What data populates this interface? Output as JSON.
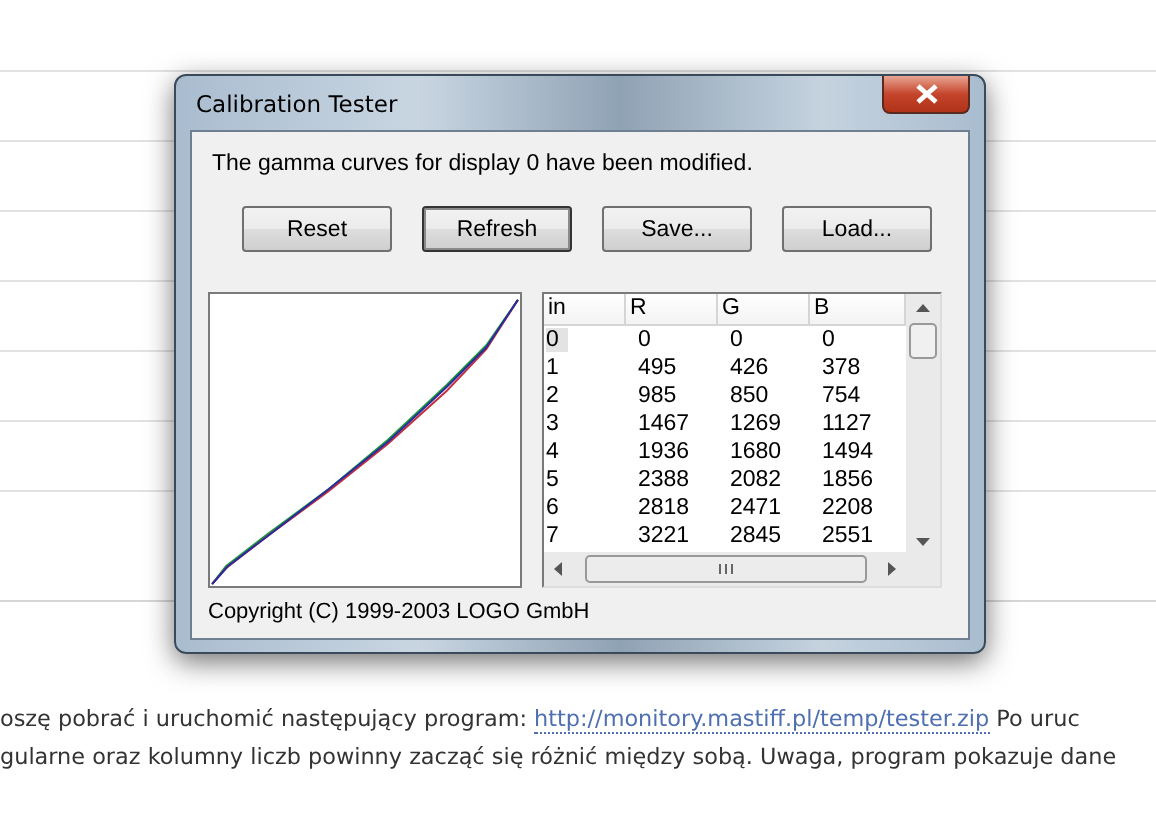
{
  "window": {
    "title": "Calibration Tester"
  },
  "message": "The gamma curves for display 0 have been modified.",
  "buttons": [
    {
      "label": "Reset",
      "default": false
    },
    {
      "label": "Refresh",
      "default": true
    },
    {
      "label": "Save...",
      "default": false
    },
    {
      "label": "Load...",
      "default": false
    }
  ],
  "table": {
    "columns": [
      "in",
      "R",
      "G",
      "B"
    ],
    "rows": [
      {
        "cells": [
          "0",
          "0",
          "0",
          "0"
        ],
        "selected": true
      },
      {
        "cells": [
          "1",
          "495",
          "426",
          "378"
        ],
        "selected": false
      },
      {
        "cells": [
          "2",
          "985",
          "850",
          "754"
        ],
        "selected": false
      },
      {
        "cells": [
          "3",
          "1467",
          "1269",
          "1127"
        ],
        "selected": false
      },
      {
        "cells": [
          "4",
          "1936",
          "1680",
          "1494"
        ],
        "selected": false
      },
      {
        "cells": [
          "5",
          "2388",
          "2082",
          "1856"
        ],
        "selected": false
      },
      {
        "cells": [
          "6",
          "2818",
          "2471",
          "2208"
        ],
        "selected": false
      },
      {
        "cells": [
          "7",
          "3221",
          "2845",
          "2551"
        ],
        "selected": false
      }
    ]
  },
  "copyright": "Copyright (C) 1999-2003 LOGO GmbH",
  "page_text": {
    "line_1_before": "oszę pobrać i uruchomić następujący program: ",
    "line_1_link": "http://monitory.mastiff.pl/temp/tester.zip",
    "line_1_after": " Po uruc",
    "line_2": "gularne oraz kolumny liczb powinny zacząć się różnić między sobą. Uwaga, program pokazuje dane"
  }
}
